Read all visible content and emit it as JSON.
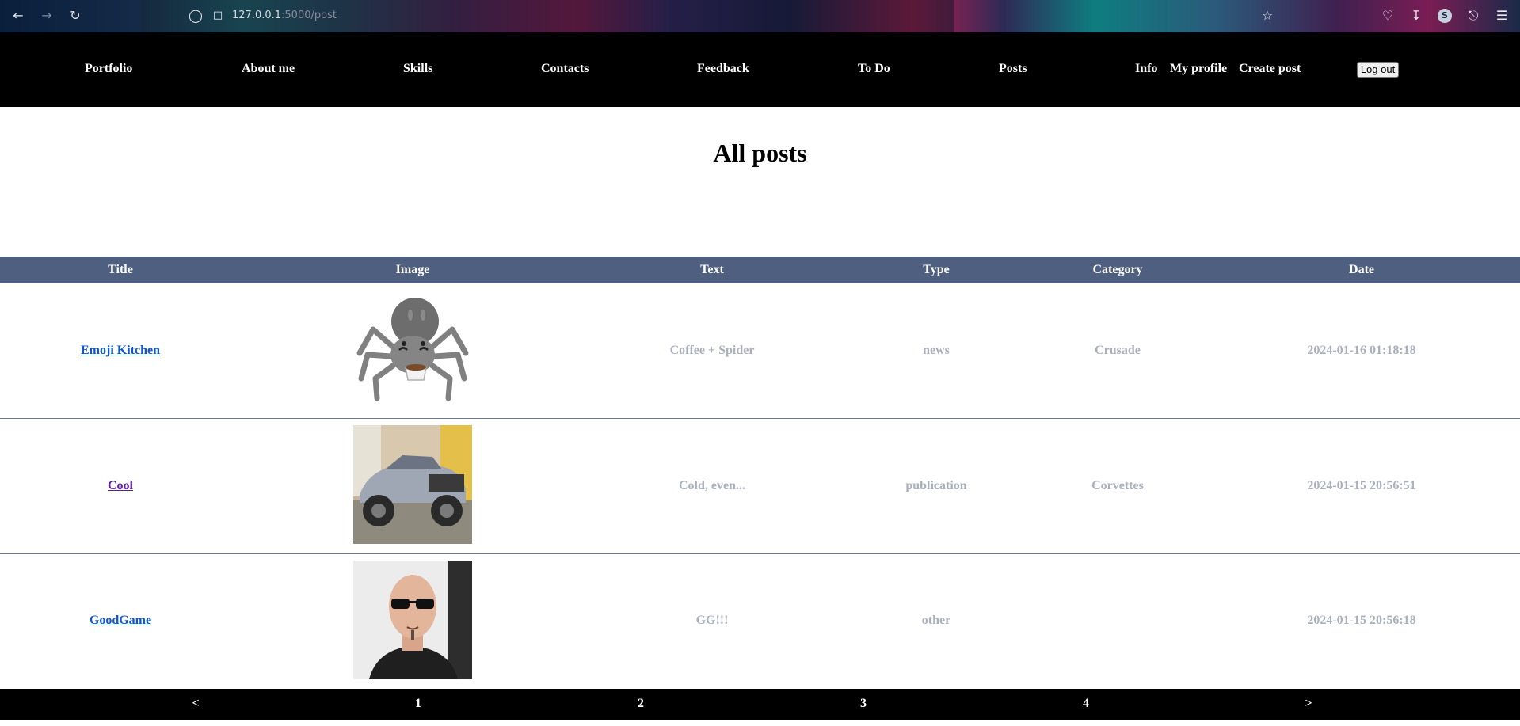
{
  "browser": {
    "url_host": "127.0.0.1",
    "url_rest": ":5000/post",
    "profile_initial": "S"
  },
  "nav": {
    "items": [
      "Portfolio",
      "About me",
      "Skills",
      "Contacts",
      "Feedback",
      "To Do",
      "Posts",
      "Info",
      "My profile",
      "Create post"
    ],
    "logout_label": "Log out"
  },
  "page": {
    "title": "All posts"
  },
  "table": {
    "headers": [
      "Title",
      "Image",
      "Text",
      "Type",
      "Category",
      "Date"
    ],
    "rows": [
      {
        "title": "Emoji Kitchen",
        "image": "spider-with-coffee-emoji",
        "text": "Coffee + Spider",
        "type": "news",
        "category": "Crusade",
        "date": "2024-01-16 01:18:18"
      },
      {
        "title": "Cool",
        "image": "lifted-corvette-photo",
        "text": "Cold, even...",
        "type": "publication",
        "category": "Corvettes",
        "date": "2024-01-15 20:56:51"
      },
      {
        "title": "GoodGame",
        "image": "bald-man-sunglasses-photo",
        "text": "GG!!!",
        "type": "other",
        "category": "",
        "date": "2024-01-15 20:56:18"
      }
    ]
  },
  "pagination": {
    "prev": "<",
    "pages": [
      "1",
      "2",
      "3",
      "4"
    ],
    "next": ">"
  }
}
